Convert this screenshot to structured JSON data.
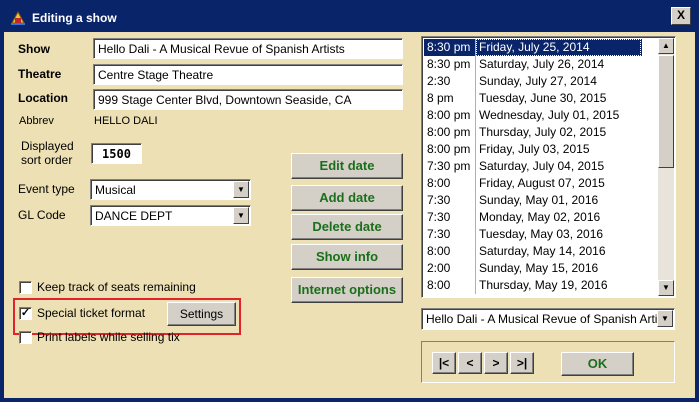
{
  "window": {
    "title": "Editing a show",
    "close_label": "X"
  },
  "form": {
    "show_label": "Show",
    "show_value": "Hello Dali - A Musical Revue of Spanish Artists",
    "theatre_label": "Theatre",
    "theatre_value": "Centre Stage Theatre",
    "location_label": "Location",
    "location_value": "999 Stage Center Blvd, Downtown Seaside, CA",
    "abbrev_label": "Abbrev",
    "abbrev_value": "HELLO DALI",
    "sort_order_label_line1": "Displayed",
    "sort_order_label_line2": "sort order",
    "sort_order_value": "1500",
    "event_type_label": "Event type",
    "event_type_value": "Musical",
    "gl_code_label": "GL Code",
    "gl_code_value": "DANCE DEPT"
  },
  "buttons": {
    "edit_date": "Edit date",
    "add_date": "Add date",
    "delete_date": "Delete date",
    "show_info": "Show info",
    "internet_options": "Internet options",
    "settings": "Settings",
    "ok": "OK"
  },
  "checkboxes": {
    "keep_track": {
      "label": "Keep track of seats remaining",
      "checked": false
    },
    "special_ticket": {
      "label": "Special ticket format",
      "checked": true
    },
    "print_labels": {
      "label": "Print labels while selling tix",
      "checked": false
    }
  },
  "dates": [
    {
      "time": "8:30 pm",
      "date": "Friday, July 25, 2014",
      "selected": true
    },
    {
      "time": "8:30 pm",
      "date": "Saturday, July 26, 2014"
    },
    {
      "time": "2:30",
      "date": "Sunday, July 27, 2014"
    },
    {
      "time": "8 pm",
      "date": "Tuesday, June 30, 2015"
    },
    {
      "time": "8:00 pm",
      "date": "Wednesday, July 01, 2015"
    },
    {
      "time": "8:00 pm",
      "date": "Thursday, July 02, 2015"
    },
    {
      "time": "8:00 pm",
      "date": "Friday, July 03, 2015"
    },
    {
      "time": "7:30 pm",
      "date": "Saturday, July 04, 2015"
    },
    {
      "time": "8:00",
      "date": "Friday, August 07, 2015"
    },
    {
      "time": "7:30",
      "date": "Sunday, May 01, 2016"
    },
    {
      "time": "7:30",
      "date": "Monday, May 02, 2016"
    },
    {
      "time": "7:30",
      "date": "Tuesday, May 03, 2016"
    },
    {
      "time": "8:00",
      "date": "Saturday, May 14, 2016"
    },
    {
      "time": "2:00",
      "date": "Sunday, May 15, 2016"
    },
    {
      "time": "8:00",
      "date": "Thursday, May 19, 2016"
    }
  ],
  "show_selector_value": "Hello Dali - A Musical Revue of Spanish Arti",
  "nav": {
    "first": "|<",
    "prev": "<",
    "next": ">",
    "last": ">|"
  },
  "colors": {
    "titlebar": "#0a246a",
    "panel": "#ece0b4",
    "button_text": "#1b6f1b",
    "highlight": "#e0242a"
  }
}
